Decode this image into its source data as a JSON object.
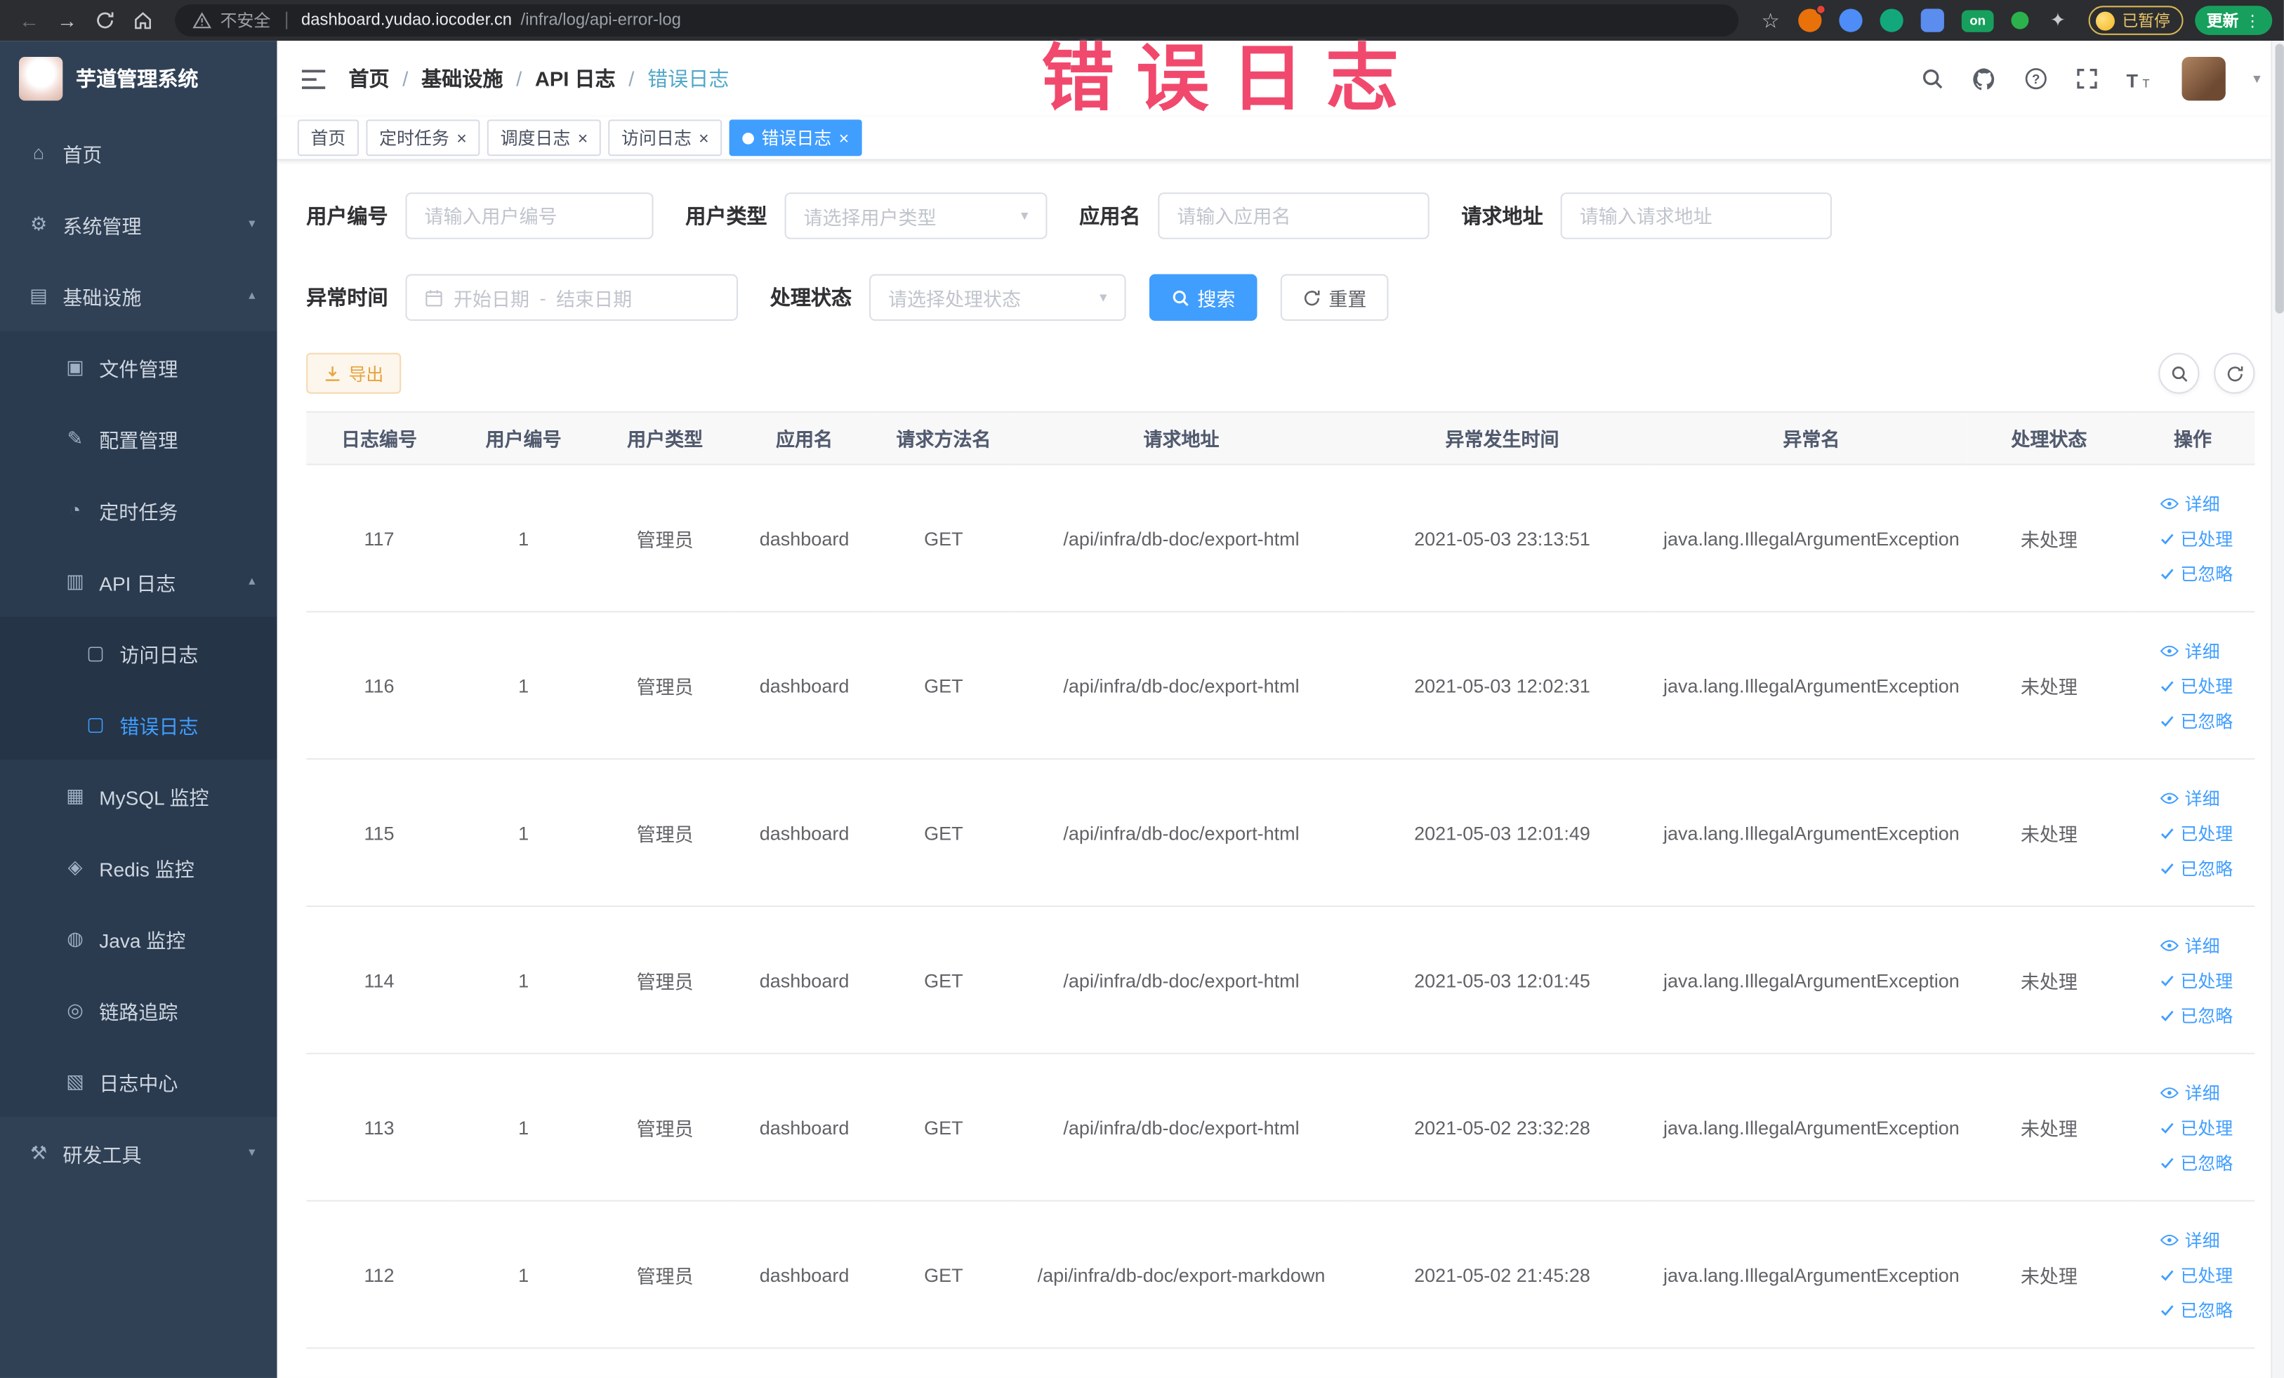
{
  "browser": {
    "security_label": "不安全",
    "url_host": "dashboard.yudao.iocoder.cn",
    "url_path": "/infra/log/api-error-log",
    "extension_on_badge": "on",
    "paused_badge": "已暂停",
    "update_label": "更新"
  },
  "sidebar": {
    "logo_title": "芋道管理系统",
    "items": [
      {
        "name": "home",
        "label": "首页",
        "icon": "home-icon",
        "level": 1
      },
      {
        "name": "system",
        "label": "系统管理",
        "icon": "gear-icon",
        "level": 1,
        "type": "submenu",
        "state": "collapsed"
      },
      {
        "name": "infra",
        "label": "基础设施",
        "icon": "infra-icon",
        "level": 1,
        "type": "submenu",
        "state": "expanded"
      },
      {
        "name": "file",
        "label": "文件管理",
        "icon": "file-icon",
        "level": 2
      },
      {
        "name": "config",
        "label": "配置管理",
        "icon": "config-icon",
        "level": 2
      },
      {
        "name": "job",
        "label": "定时任务",
        "icon": "job-icon",
        "level": 2
      },
      {
        "name": "api-log",
        "label": "API 日志",
        "icon": "api-log-icon",
        "level": 2,
        "type": "submenu",
        "state": "expanded"
      },
      {
        "name": "access-log",
        "label": "访问日志",
        "icon": "doc-icon",
        "level": 3
      },
      {
        "name": "error-log",
        "label": "错误日志",
        "icon": "doc-icon",
        "level": 3,
        "active": true
      },
      {
        "name": "mysql",
        "label": "MySQL 监控",
        "icon": "mysql-icon",
        "level": 2
      },
      {
        "name": "redis",
        "label": "Redis 监控",
        "icon": "redis-icon",
        "level": 2
      },
      {
        "name": "java",
        "label": "Java 监控",
        "icon": "java-icon",
        "level": 2
      },
      {
        "name": "trace",
        "label": "链路追踪",
        "icon": "trace-icon",
        "level": 2
      },
      {
        "name": "log-center",
        "label": "日志中心",
        "icon": "log-center-icon",
        "level": 2
      },
      {
        "name": "dev-tools",
        "label": "研发工具",
        "icon": "tools-icon",
        "level": 1,
        "type": "submenu",
        "state": "collapsed"
      }
    ]
  },
  "overlay": {
    "title": "错误日志"
  },
  "header": {
    "breadcrumb": [
      "首页",
      "基础设施",
      "API 日志",
      "错误日志"
    ]
  },
  "tags": [
    {
      "name": "home",
      "label": "首页",
      "closable": false,
      "active": false
    },
    {
      "name": "job",
      "label": "定时任务",
      "closable": true,
      "active": false
    },
    {
      "name": "job-log",
      "label": "调度日志",
      "closable": true,
      "active": false
    },
    {
      "name": "access-log",
      "label": "访问日志",
      "closable": true,
      "active": false
    },
    {
      "name": "error-log",
      "label": "错误日志",
      "closable": true,
      "active": true
    }
  ],
  "filters": {
    "user_id_label": "用户编号",
    "user_id_placeholder": "请输入用户编号",
    "user_type_label": "用户类型",
    "user_type_placeholder": "请选择用户类型",
    "app_label": "应用名",
    "app_placeholder": "请输入应用名",
    "url_label": "请求地址",
    "url_placeholder": "请输入请求地址",
    "time_label": "异常时间",
    "time_start_placeholder": "开始日期",
    "time_separator": "-",
    "time_end_placeholder": "结束日期",
    "status_label": "处理状态",
    "status_placeholder": "请选择处理状态",
    "search_label": "搜索",
    "reset_label": "重置"
  },
  "toolbar": {
    "export_label": "导出"
  },
  "table": {
    "columns": [
      "日志编号",
      "用户编号",
      "用户类型",
      "应用名",
      "请求方法名",
      "请求地址",
      "异常发生时间",
      "异常名",
      "处理状态",
      "操作"
    ],
    "rows": [
      [
        "117",
        "1",
        "管理员",
        "dashboard",
        "GET",
        "/api/infra/db-doc/export-html",
        "2021-05-03 23:13:51",
        "java.lang.IllegalArgumentException",
        "未处理"
      ],
      [
        "116",
        "1",
        "管理员",
        "dashboard",
        "GET",
        "/api/infra/db-doc/export-html",
        "2021-05-03 12:02:31",
        "java.lang.IllegalArgumentException",
        "未处理"
      ],
      [
        "115",
        "1",
        "管理员",
        "dashboard",
        "GET",
        "/api/infra/db-doc/export-html",
        "2021-05-03 12:01:49",
        "java.lang.IllegalArgumentException",
        "未处理"
      ],
      [
        "114",
        "1",
        "管理员",
        "dashboard",
        "GET",
        "/api/infra/db-doc/export-html",
        "2021-05-03 12:01:45",
        "java.lang.IllegalArgumentException",
        "未处理"
      ],
      [
        "113",
        "1",
        "管理员",
        "dashboard",
        "GET",
        "/api/infra/db-doc/export-html",
        "2021-05-02 23:32:28",
        "java.lang.IllegalArgumentException",
        "未处理"
      ],
      [
        "112",
        "1",
        "管理员",
        "dashboard",
        "GET",
        "/api/infra/db-doc/export-markdown",
        "2021-05-02 21:45:28",
        "java.lang.IllegalArgumentException",
        "未处理"
      ]
    ],
    "actions": [
      {
        "name": "detail",
        "label": "详细",
        "icon": "eye-icon"
      },
      {
        "name": "processed",
        "label": "已处理",
        "icon": "check-icon"
      },
      {
        "name": "ignored",
        "label": "已忽略",
        "icon": "check-icon"
      }
    ]
  }
}
